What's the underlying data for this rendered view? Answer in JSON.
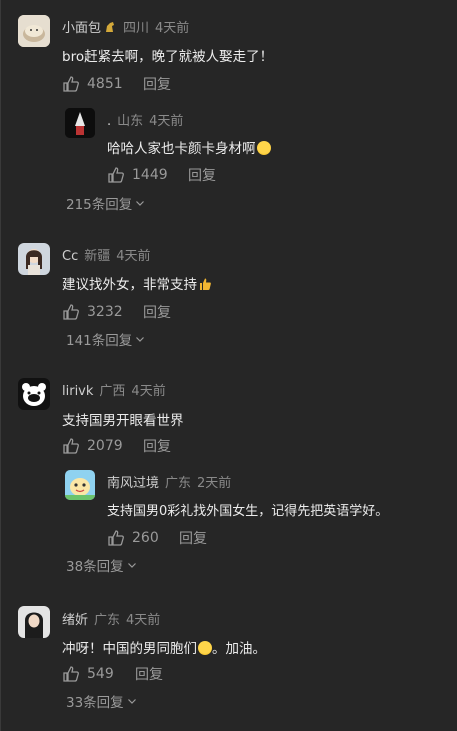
{
  "comments": [
    {
      "username": "小面包",
      "region": "四川",
      "time": "4天前",
      "text": "bro赶紧去啊，晚了就被人娶走了！",
      "likes": "4851",
      "reply_label": "回复",
      "reply": {
        "username": ".",
        "region": "山东",
        "time": "4天前",
        "text": "哈哈人家也卡颜卡身材啊",
        "likes": "1449",
        "reply_label": "回复"
      },
      "more_replies": "215条回复"
    },
    {
      "username": "Cc",
      "region": "新疆",
      "time": "4天前",
      "text": "建议找外女，非常支持",
      "likes": "3232",
      "reply_label": "回复",
      "more_replies": "141条回复"
    },
    {
      "username": "lirivk",
      "region": "广西",
      "time": "4天前",
      "text": "支持国男开眼看世界",
      "likes": "2079",
      "reply_label": "回复",
      "reply": {
        "username": "南风过境",
        "region": "广东",
        "time": "2天前",
        "text": "支持国男0彩礼找外国女生，记得先把英语学好。",
        "likes": "260",
        "reply_label": "回复"
      },
      "more_replies": "38条回复"
    },
    {
      "username": "绪妡",
      "region": "广东",
      "time": "4天前",
      "text": "冲呀！中国的男同胞们",
      "text_after": "。加油。",
      "likes": "549",
      "reply_label": "回复",
      "more_replies": "33条回复"
    }
  ],
  "icons": {
    "like": "thumbs-up-icon",
    "more": "chevron-down-icon",
    "badge": "horse-badge-icon"
  },
  "colors": {
    "background": "#262626",
    "text": "#ececec",
    "muted": "#8a8a8a"
  }
}
